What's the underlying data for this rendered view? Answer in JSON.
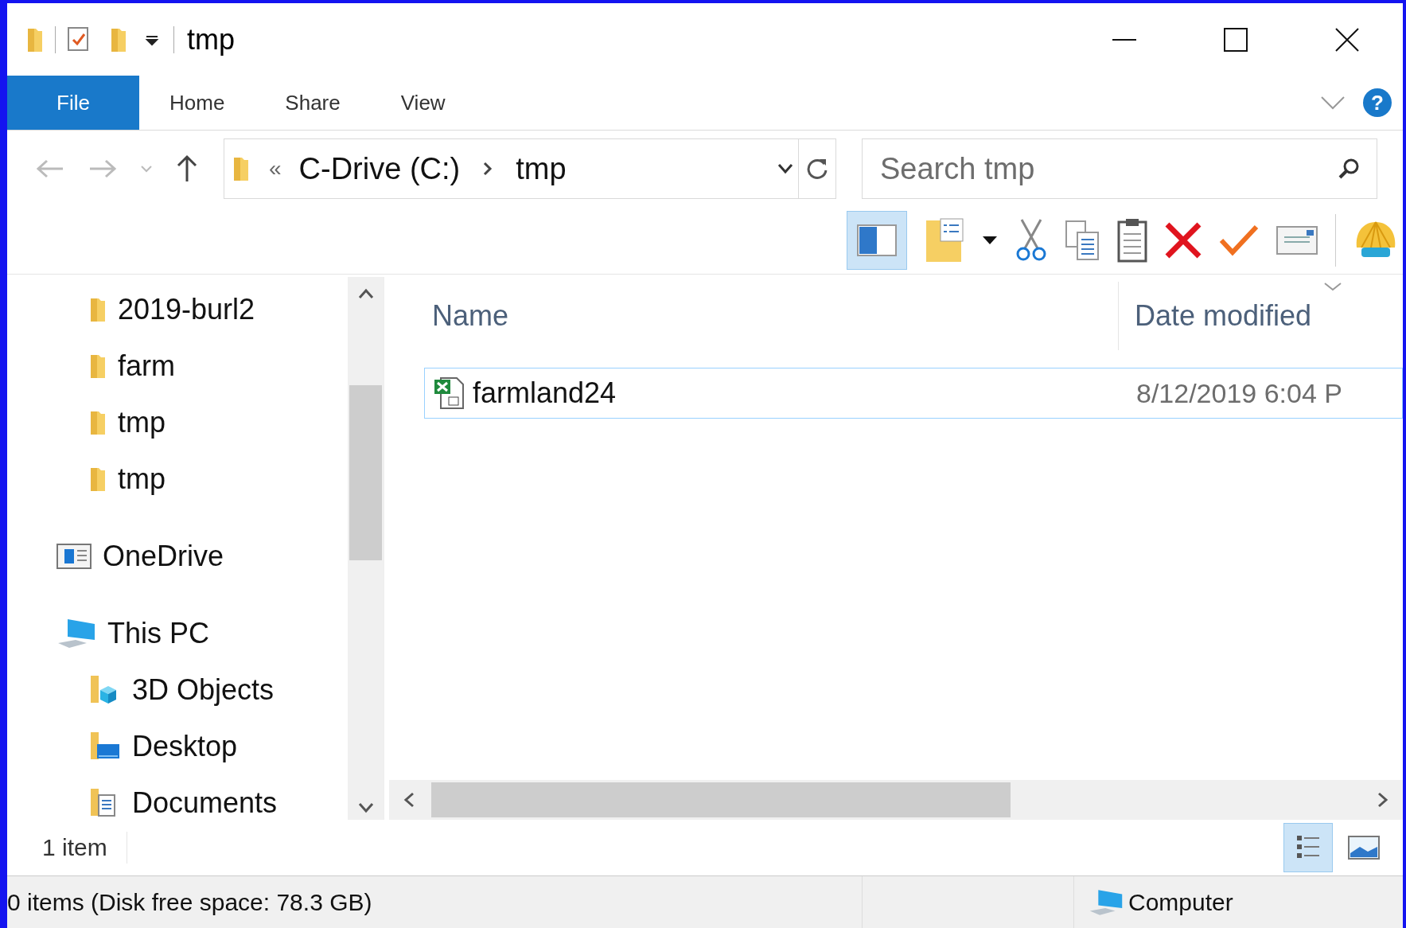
{
  "window": {
    "title": "tmp"
  },
  "ribbon": {
    "tabs": [
      {
        "label": "File",
        "selected": true
      },
      {
        "label": "Home",
        "selected": false
      },
      {
        "label": "Share",
        "selected": false
      },
      {
        "label": "View",
        "selected": false
      }
    ],
    "help": "?"
  },
  "address_bar": {
    "overflow": "«",
    "path": [
      "C-Drive (C:)",
      "tmp"
    ]
  },
  "search": {
    "placeholder": "Search tmp"
  },
  "navigation": {
    "items": [
      {
        "children": [
          {
            "label": "2019-burl2",
            "kind": "folder"
          },
          {
            "label": "farm",
            "kind": "folder"
          },
          {
            "label": "tmp",
            "kind": "folder"
          },
          {
            "label": "tmp",
            "kind": "folder"
          }
        ]
      },
      {
        "label": "OneDrive",
        "kind": "onedrive"
      },
      {
        "label": "This PC",
        "kind": "pc",
        "children": [
          {
            "label": "3D Objects",
            "kind": "objects3d"
          },
          {
            "label": "Desktop",
            "kind": "desktop"
          },
          {
            "label": "Documents",
            "kind": "documents"
          }
        ]
      }
    ]
  },
  "file_list": {
    "columns": [
      "Name",
      "Date modified"
    ],
    "rows": [
      {
        "name": "farmland24",
        "date_modified": "8/12/2019 6:04 P",
        "focused": true
      }
    ]
  },
  "details_bar": {
    "item_count": "1 item",
    "views": [
      {
        "kind": "details",
        "selected": true
      },
      {
        "kind": "large_icons",
        "selected": false
      }
    ]
  },
  "status_bar": {
    "text": "0 items (Disk free space: 78.3 GB)",
    "location": "Computer"
  }
}
